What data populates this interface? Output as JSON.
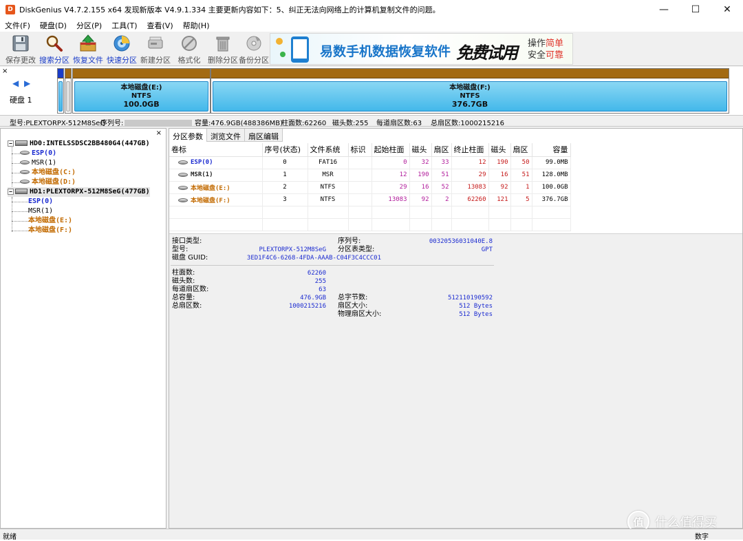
{
  "titlebar": {
    "logo": "D",
    "title": "DiskGenius V4.7.2.155 x64   发现新版本 V4.9.1.334 主要更新内容如下：5、纠正无法向网络上的计算机复制文件的问题。",
    "minimize": "—",
    "maximize": "☐",
    "close": "✕"
  },
  "menu": [
    "文件(F)",
    "硬盘(D)",
    "分区(P)",
    "工具(T)",
    "查看(V)",
    "帮助(H)"
  ],
  "toolbar": {
    "buttons": [
      {
        "label": "保存更改",
        "style": "gray",
        "icon": "floppy-disk-icon"
      },
      {
        "label": "搜索分区",
        "style": "blue",
        "icon": "magnifier-icon"
      },
      {
        "label": "恢复文件",
        "style": "blue",
        "icon": "restore-box-icon"
      },
      {
        "label": "快速分区",
        "style": "blue",
        "icon": "quick-partition-disc-icon"
      },
      {
        "label": "新建分区",
        "style": "gray",
        "icon": "new-partition-icon"
      },
      {
        "label": "格式化",
        "style": "gray",
        "icon": "format-icon"
      },
      {
        "label": "删除分区",
        "style": "gray",
        "icon": "trash-icon"
      },
      {
        "label": "备份分区",
        "style": "gray",
        "icon": "backup-disc-icon"
      }
    ]
  },
  "banner": {
    "text": "易数手机数据恢复软件",
    "free": "免费试用",
    "side_line1_a": "操作",
    "side_line1_b": "简单",
    "side_line2_a": "安全",
    "side_line2_b": "可靠"
  },
  "diskmap": {
    "close": "×",
    "arrows": "◀ ▶",
    "label": "硬盘 1",
    "partitions": [
      {
        "name": "本地磁盘(E:)",
        "fs": "NTFS",
        "size": "100.0GB"
      },
      {
        "name": "本地磁盘(F:)",
        "fs": "NTFS",
        "size": "376.7GB"
      }
    ]
  },
  "diskinfo": {
    "model": "型号:PLEXTORPX-512M8SeG",
    "serial": "序列号:",
    "capacity": "容量:476.9GB(488386MB)",
    "cylinders": "柱面数:62260",
    "heads": "磁头数:255",
    "sectors_per_track": "每道扇区数:63",
    "total_sectors": "总扇区数:1000215216"
  },
  "tree": {
    "close": "×",
    "nodes": [
      {
        "text": "HD0:INTELSSDSC2BB480G4(447GB)"
      },
      {
        "text": "ESP(0)"
      },
      {
        "text": "MSR(1)"
      },
      {
        "text": "本地磁盘(C:)"
      },
      {
        "text": "本地磁盘(D:)"
      },
      {
        "text": "HD1:PLEXTORPX-512M8SeG(477GB)"
      },
      {
        "text": "ESP(0)"
      },
      {
        "text": "MSR(1)"
      },
      {
        "text": "本地磁盘(E:)"
      },
      {
        "text": "本地磁盘(F:)"
      }
    ]
  },
  "tabs": [
    "分区参数",
    "浏览文件",
    "扇区编辑"
  ],
  "table": {
    "headers": [
      "卷标",
      "序号(状态)",
      "文件系统",
      "标识",
      "起始柱面",
      "磁头",
      "扇区",
      "终止柱面",
      "磁头",
      "扇区",
      "容量"
    ],
    "rows": [
      {
        "name": "ESP(0)",
        "color": "blue",
        "idx": "0",
        "fs": "FAT16",
        "flag": "",
        "sc": "0",
        "sh": "32",
        "ss": "33",
        "ec": "12",
        "eh": "190",
        "es": "50",
        "cap": "99.0MB"
      },
      {
        "name": "MSR(1)",
        "color": "plain",
        "idx": "1",
        "fs": "MSR",
        "flag": "",
        "sc": "12",
        "sh": "190",
        "ss": "51",
        "ec": "29",
        "eh": "16",
        "es": "51",
        "cap": "128.0MB"
      },
      {
        "name": "本地磁盘(E:)",
        "color": "orange",
        "idx": "2",
        "fs": "NTFS",
        "flag": "",
        "sc": "29",
        "sh": "16",
        "ss": "52",
        "ec": "13083",
        "eh": "92",
        "es": "1",
        "cap": "100.0GB"
      },
      {
        "name": "本地磁盘(F:)",
        "color": "orange",
        "idx": "3",
        "fs": "NTFS",
        "flag": "",
        "sc": "13083",
        "sh": "92",
        "ss": "2",
        "ec": "62260",
        "eh": "121",
        "es": "5",
        "cap": "376.7GB"
      }
    ]
  },
  "details": {
    "interface_label": "接口类型:",
    "interface_value": "",
    "serial_label": "序列号:",
    "serial_value": "00320536031040E.8",
    "model_label": "型号:",
    "model_value": "PLEXTORPX-512M8SeG",
    "ptable_label": "分区表类型:",
    "ptable_value": "GPT",
    "guid_label": "磁盘 GUID:",
    "guid_value": "3ED1F4C6-6268-4FDA-AAAB-C04F3C4CCC01",
    "cyl_label": "柱面数:",
    "cyl_value": "62260",
    "heads_label": "磁头数:",
    "heads_value": "255",
    "spt_label": "每道扇区数:",
    "spt_value": "63",
    "cap_label": "总容量:",
    "cap_value": "476.9GB",
    "bytes_label": "总字节数:",
    "bytes_value": "512110190592",
    "ts_label": "总扇区数:",
    "ts_value": "1000215216",
    "ss_label": "扇区大小:",
    "ss_value": "512 Bytes",
    "pss_label": "物理扇区大小:",
    "pss_value": "512 Bytes"
  },
  "status": {
    "left": "就绪",
    "right": "数字"
  },
  "watermark": {
    "mark": "值",
    "text": "什么值得买"
  }
}
